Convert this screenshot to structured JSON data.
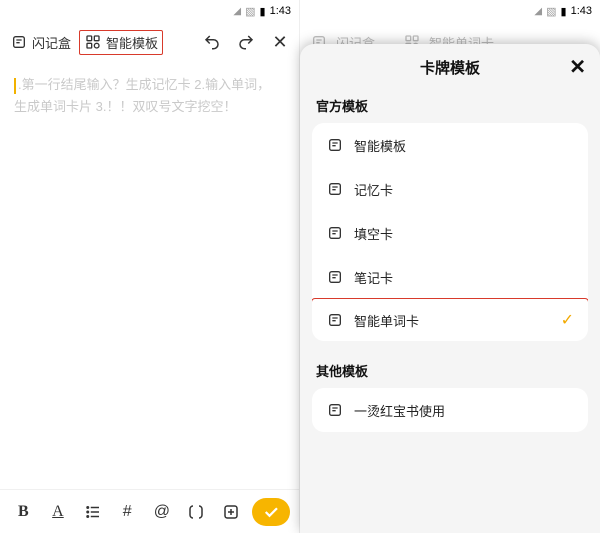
{
  "status": {
    "time": "1:43",
    "battery_icon": "▮",
    "signal_icon": "◢"
  },
  "left": {
    "flashbox": {
      "label": "闪记盒"
    },
    "smart_template": {
      "label": "智能模板"
    },
    "placeholder_line1": ".第一行结尾输入？生成记忆卡 2.输入单词，",
    "placeholder_line2": "生成单词卡片 3.！！双叹号文字挖空！"
  },
  "right": {
    "dim_flashbox": "闪记盒",
    "dim_template": "智能单词卡",
    "sheet_title": "卡牌模板",
    "section_official": "官方模板",
    "section_other": "其他模板",
    "templates_official": [
      {
        "label": "智能模板"
      },
      {
        "label": "记忆卡"
      },
      {
        "label": "填空卡"
      },
      {
        "label": "笔记卡"
      },
      {
        "label": "智能单词卡",
        "selected": true
      }
    ],
    "templates_other": [
      {
        "label": "一烫红宝书使用"
      }
    ]
  }
}
